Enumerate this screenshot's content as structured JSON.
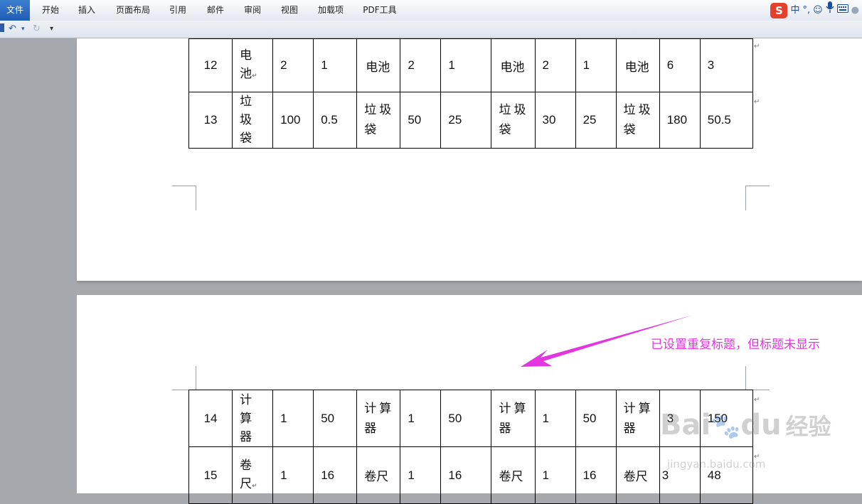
{
  "ribbon": {
    "tabs": [
      "文件",
      "开始",
      "插入",
      "页面布局",
      "引用",
      "邮件",
      "审阅",
      "视图",
      "加载项",
      "PDF工具"
    ],
    "tray": {
      "logo": "S",
      "ime_mode": "中",
      "punct": "°,"
    }
  },
  "quickbar": {
    "more": "▾"
  },
  "table_top": {
    "rows": [
      {
        "num": "12",
        "item1": [
          "电",
          "池"
        ],
        "a": "2",
        "b": "1",
        "item2": "电池",
        "c": "2",
        "d": "1",
        "item3": "电池",
        "e": "2",
        "f": "1",
        "item4": "电池",
        "g": "6",
        "h": "3"
      },
      {
        "num": "13",
        "item1": [
          "垃",
          "圾",
          "袋"
        ],
        "a": "100",
        "b": "0.5",
        "item2": [
          "垃圾",
          "袋"
        ],
        "c": "50",
        "d": "25",
        "item3": [
          "垃圾",
          "袋"
        ],
        "e": "30",
        "f": "25",
        "item4": [
          "垃圾",
          "袋"
        ],
        "g": "180",
        "h": "50.5"
      }
    ]
  },
  "table_bottom": {
    "rows": [
      {
        "num": "14",
        "item1": [
          "计",
          "算",
          "器"
        ],
        "a": "1",
        "b": "50",
        "item2": [
          "计算",
          "器"
        ],
        "c": "1",
        "d": "50",
        "item3": [
          "计算",
          "器"
        ],
        "e": "1",
        "f": "50",
        "item4": [
          "计算",
          "器"
        ],
        "g": "3",
        "h": "150"
      },
      {
        "num": "15",
        "item1": [
          "卷",
          "尺"
        ],
        "a": "1",
        "b": "16",
        "item2": "卷尺",
        "c": "1",
        "d": "16",
        "item3": "卷尺",
        "e": "1",
        "f": "16",
        "item4": "卷尺",
        "g": "3",
        "h": "48"
      }
    ]
  },
  "annotation": {
    "text": "已设置重复标题，但标题未显示",
    "color": "#e335e0"
  },
  "watermark": {
    "brand": "Bai",
    "brand2": "du",
    "cn": "经验",
    "url": "jingyan.baidu.com"
  },
  "colors": {
    "active_tab": "#2a6bc3",
    "arrow": "#e335e0"
  }
}
